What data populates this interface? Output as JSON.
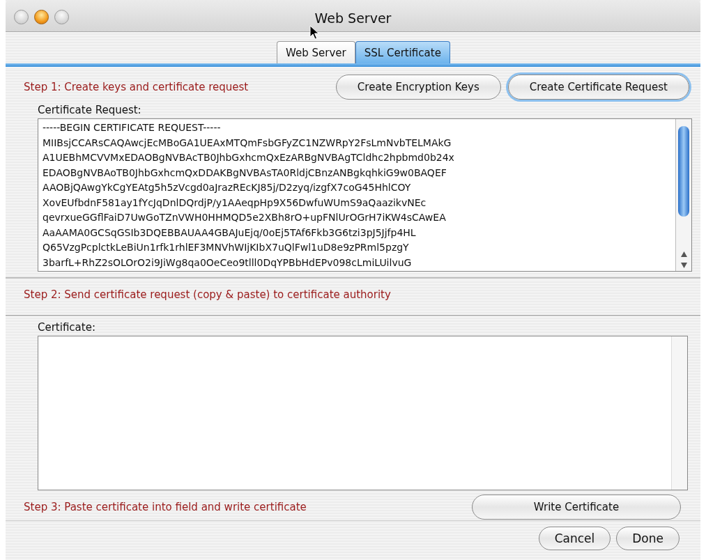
{
  "window": {
    "title": "Web Server",
    "controls": [
      {
        "active": false
      },
      {
        "active": true
      },
      {
        "active": false
      }
    ]
  },
  "tabs": [
    {
      "label": "Web Server",
      "selected": false
    },
    {
      "label": "SSL Certificate",
      "selected": true
    }
  ],
  "step1": {
    "label": "Step 1: Create keys and certificate request",
    "buttons": [
      {
        "label": "Create Encryption Keys",
        "focused": false
      },
      {
        "label": "Create Certificate Request",
        "focused": true
      }
    ],
    "request_label": "Certificate Request:",
    "request_lines": [
      "-----BEGIN CERTIFICATE REQUEST-----",
      "MIIBsjCCARsCAQAwcjEcMBoGA1UEAxMTQmFsbGFyZC1NZWRpY2FsLmNvbTELMAkG",
      "A1UEBhMCVVMxEDAOBgNVBAcTB0JhbGxhcmQxEzARBgNVBAgTCldhc2hpbmd0b24x",
      "EDAOBgNVBAoTB0JhbGxhcmQxDDAKBgNVBAsTA0RldjCBnzANBgkqhkiG9w0BAQEF",
      "AAOBjQAwgYkCgYEAtg5h5zVcgd0aJrazREcKJ85j/D2zyq/izgfX7coG45HhlCOY",
      "XovEUfbdnF581ay1fYcJqDnlDQrdjP/y1AAeqpHp9X56DwfuWUmS9aQaazikvNEc",
      "qevrxueGGflFaiD7UwGoTZnVWH0HHMQD5e2XBh8rO+upFNlUrOGrH7iKW4sCAwEA",
      "AaAAMA0GCSqGSIb3DQEBBAUAA4GBAJuEjq/0oEj5TAf6Fkb3G6tzi3pJ5Jjfp4HL",
      "Q65VzgPcplctkLeBiUn1rfk1rhlEF3MNVhWIjKIbX7uQlFwl1uD8e9zPRml5pzgY",
      "3barfL+RhZ2sOLOrO2i9JiWg8qa0OeCeo9tlll0DqYPBbHdEPv098cLmiLUilvuG"
    ]
  },
  "step2": {
    "label": "Step 2: Send certificate request (copy & paste) to certificate authority"
  },
  "step3": {
    "certificate_label": "Certificate:",
    "label": "Step 3: Paste certificate into field and write certificate",
    "button": "Write Certificate"
  },
  "footer_buttons": [
    "Cancel",
    "Done"
  ]
}
